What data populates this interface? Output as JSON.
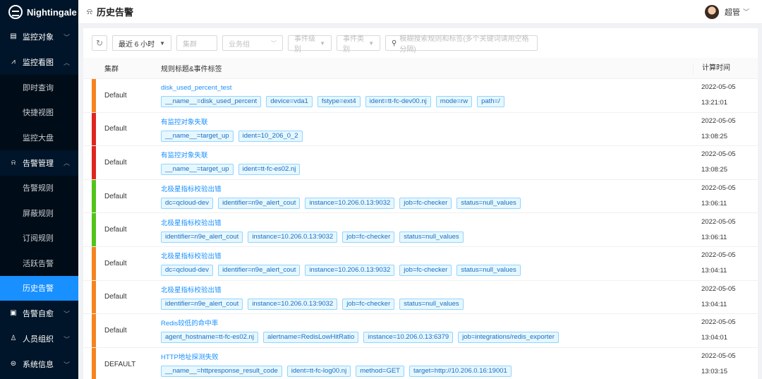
{
  "app": {
    "name": "Nightingale"
  },
  "header": {
    "title": "历史告警",
    "user_name": "超管"
  },
  "sidebar": {
    "items": [
      {
        "label": "监控对象",
        "type": "group",
        "arrow": "﹀",
        "icon": "monitor-object-icon"
      },
      {
        "label": "监控看图",
        "type": "group",
        "arrow": "︿",
        "icon": "chart-icon"
      },
      {
        "label": "即时查询",
        "type": "sub"
      },
      {
        "label": "快捷视图",
        "type": "sub"
      },
      {
        "label": "监控大盘",
        "type": "sub"
      },
      {
        "label": "告警管理",
        "type": "group",
        "arrow": "︿",
        "icon": "alarm-icon"
      },
      {
        "label": "告警规则",
        "type": "sub"
      },
      {
        "label": "屏蔽规则",
        "type": "sub"
      },
      {
        "label": "订阅规则",
        "type": "sub"
      },
      {
        "label": "活跃告警",
        "type": "sub"
      },
      {
        "label": "历史告警",
        "type": "sub",
        "active": true
      },
      {
        "label": "告警自愈",
        "type": "group",
        "arrow": "﹀",
        "icon": "self-heal-icon"
      },
      {
        "label": "人员组织",
        "type": "group",
        "arrow": "﹀",
        "icon": "user-icon"
      },
      {
        "label": "系统信息",
        "type": "group",
        "arrow": "﹀",
        "icon": "info-icon"
      }
    ]
  },
  "filters": {
    "time_range": "最近 6 小时",
    "cluster_placeholder": "集群",
    "business_placeholder": "业务组",
    "level_placeholder": "事件级别",
    "type_placeholder": "事件类别",
    "search_placeholder": "模糊搜索规则和标签(多个关键词请用空格分隔)"
  },
  "table": {
    "columns": [
      "集群",
      "规则标题&事件标签",
      "计算时间"
    ],
    "rows": [
      {
        "cluster": "Default",
        "severity_color": "#f5841f",
        "title": "disk_used_percent_test",
        "tags": [
          "__name__=disk_used_percent",
          "device=vda1",
          "fstype=ext4",
          "ident=tt-fc-dev00.nj",
          "mode=rw",
          "path=/"
        ],
        "date": "2022-05-05",
        "time": "13:21:01"
      },
      {
        "cluster": "Default",
        "severity_color": "#e0251f",
        "title": "有监控对象失联",
        "tags": [
          "__name__=target_up",
          "ident=10_206_0_2"
        ],
        "date": "2022-05-05",
        "time": "13:08:25"
      },
      {
        "cluster": "Default",
        "severity_color": "#e0251f",
        "title": "有监控对象失联",
        "tags": [
          "__name__=target_up",
          "ident=tt-fc-es02.nj"
        ],
        "date": "2022-05-05",
        "time": "13:08:25"
      },
      {
        "cluster": "Default",
        "severity_color": "#52c41a",
        "title": "北极星指标校验出错",
        "tags": [
          "dc=qcloud-dev",
          "identifier=n9e_alert_cout",
          "instance=10.206.0.13:9032",
          "job=fc-checker",
          "status=null_values"
        ],
        "date": "2022-05-05",
        "time": "13:06:11"
      },
      {
        "cluster": "Default",
        "severity_color": "#52c41a",
        "title": "北极星指标校验出错",
        "tags": [
          "identifier=n9e_alert_cout",
          "instance=10.206.0.13:9032",
          "job=fc-checker",
          "status=null_values"
        ],
        "date": "2022-05-05",
        "time": "13:06:11"
      },
      {
        "cluster": "Default",
        "severity_color": "#f5841f",
        "title": "北极星指标校验出错",
        "tags": [
          "dc=qcloud-dev",
          "identifier=n9e_alert_cout",
          "instance=10.206.0.13:9032",
          "job=fc-checker",
          "status=null_values"
        ],
        "date": "2022-05-05",
        "time": "13:04:11"
      },
      {
        "cluster": "Default",
        "severity_color": "#f5841f",
        "title": "北极星指标校验出错",
        "tags": [
          "identifier=n9e_alert_cout",
          "instance=10.206.0.13:9032",
          "job=fc-checker",
          "status=null_values"
        ],
        "date": "2022-05-05",
        "time": "13:04:11"
      },
      {
        "cluster": "Default",
        "severity_color": "#f5841f",
        "title": "Redis较低的命中率",
        "tags": [
          "agent_hostname=tt-fc-es02.nj",
          "alertname=RedisLowHitRatio",
          "instance=10.206.0.13:6379",
          "job=integrations/redis_exporter"
        ],
        "date": "2022-05-05",
        "time": "13:04:01"
      },
      {
        "cluster": "DEFAULT",
        "severity_color": "#f5841f",
        "title": "HTTP地址探测失败",
        "tags": [
          "__name__=httpresponse_result_code",
          "ident=tt-fc-log00.nj",
          "method=GET",
          "target=http://10.206.0.16:19001"
        ],
        "date": "2022-05-05",
        "time": "13:03:15"
      }
    ]
  }
}
